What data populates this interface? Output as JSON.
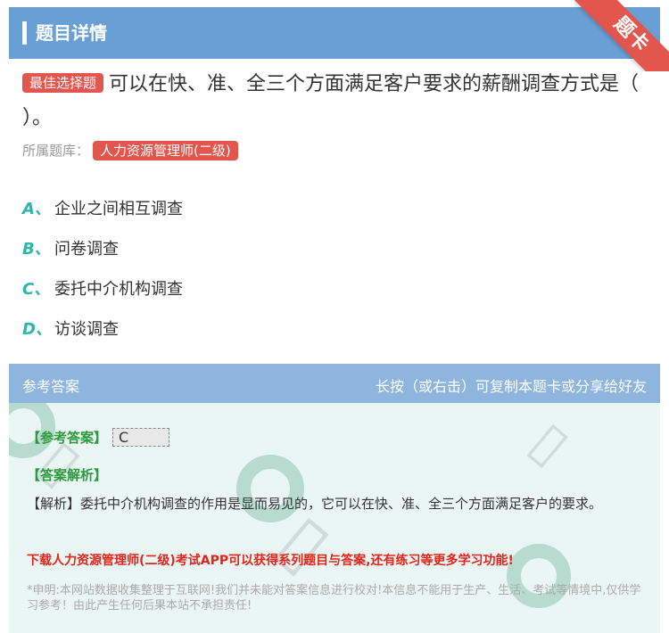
{
  "header": {
    "title": "题目详情"
  },
  "ribbon": {
    "label": "题卡"
  },
  "question": {
    "badge": "最佳选择题",
    "text": "可以在快、准、全三个方面满足客户要求的薪酬调查方式是（ ）。"
  },
  "bank": {
    "label": "所属题库：",
    "name": "人力资源管理师(二级)"
  },
  "options": [
    {
      "letter": "A、",
      "text": "企业之间相互调查"
    },
    {
      "letter": "B、",
      "text": "问卷调查"
    },
    {
      "letter": "C、",
      "text": "委托中介机构调查"
    },
    {
      "letter": "D、",
      "text": "访谈调查"
    }
  ],
  "answer_section": {
    "ref_label": "参考答案",
    "hint": "长按（或右击）可复制本题卡或分享给好友",
    "answer_label": "【参考答案】",
    "answer_value": "C",
    "explain_label": "【答案解析】",
    "explain_text": "【解析】委托中介机构调查的作用是显而易见的，它可以在快、准、全三个方面满足客户的要求。",
    "download_text": "下载人力资源管理师(二级)考试APP可以获得系列题目与答案,还有练习等更多学习功能!",
    "disclaimer": "*申明:本网站数据收集整理于互联网!我们并未能对答案信息进行校对!本信息不能用于生产、生活、考试等情境中,仅供学习参考！由此产生任何后果本站不承担责任!"
  }
}
